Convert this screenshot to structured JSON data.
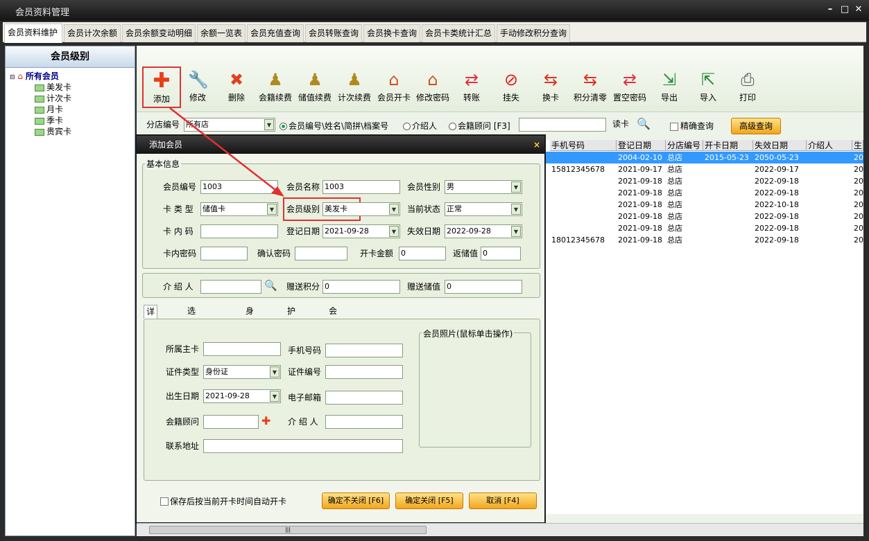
{
  "window": {
    "title": "会员资料管理"
  },
  "menu_tabs": [
    "会员资料维护",
    "会员计次余额",
    "会员余额变动明细",
    "余额一览表",
    "会员充值查询",
    "会员转账查询",
    "会员换卡查询",
    "会员卡类统计汇总",
    "手动修改积分查询"
  ],
  "left_panel": {
    "header": "会员级别",
    "root": "所有会员",
    "items": [
      "美发卡",
      "计次卡",
      "月卡",
      "季卡",
      "贵宾卡"
    ]
  },
  "toolbar": {
    "buttons": [
      {
        "label": "添加",
        "icon": "add-icon"
      },
      {
        "label": "修改",
        "icon": "wrench-icon"
      },
      {
        "label": "删除",
        "icon": "delete-icon"
      },
      {
        "label": "会籍续费",
        "icon": "pawn-icon"
      },
      {
        "label": "储值续费",
        "icon": "pawn-icon"
      },
      {
        "label": "计次续费",
        "icon": "pawn-icon"
      },
      {
        "label": "会员开卡",
        "icon": "house-icon"
      },
      {
        "label": "修改密码",
        "icon": "house-icon"
      },
      {
        "label": "转账",
        "icon": "transfer-icon"
      },
      {
        "label": "挂失",
        "icon": "ban-icon"
      },
      {
        "label": "换卡",
        "icon": "swap-icon"
      },
      {
        "label": "积分清零",
        "icon": "swap-icon"
      },
      {
        "label": "置空密码",
        "icon": "transfer-icon"
      },
      {
        "label": "导出",
        "icon": "export-icon"
      },
      {
        "label": "导入",
        "icon": "import-icon"
      },
      {
        "label": "打印",
        "icon": "print-icon"
      }
    ]
  },
  "search": {
    "branch_label": "分店编号",
    "branch_value": "所有店",
    "radio1": "会员编号\\姓名\\简拼\\档案号",
    "radio2": "介绍人",
    "radio3": "会籍顾问 [F3]",
    "read_card": "读卡",
    "exact": "精确查询",
    "advanced": "高级查询"
  },
  "grid": {
    "columns": [
      "手机号码",
      "登记日期",
      "分店编号",
      "开卡日期",
      "失效日期",
      "介绍人",
      "生"
    ],
    "rows": [
      [
        "",
        "2004-02-10",
        "总店",
        "2015-05-23",
        "2050-05-23",
        "",
        "20"
      ],
      [
        "15812345678",
        "2021-09-17",
        "总店",
        "",
        "2022-09-17",
        "",
        "20"
      ],
      [
        "",
        "2021-09-18",
        "总店",
        "",
        "2022-09-18",
        "",
        "20"
      ],
      [
        "",
        "2021-09-18",
        "总店",
        "",
        "2022-09-18",
        "",
        "20"
      ],
      [
        "",
        "2021-09-18",
        "总店",
        "",
        "2022-10-18",
        "",
        "20"
      ],
      [
        "",
        "2021-09-18",
        "总店",
        "",
        "2022-09-18",
        "",
        "20"
      ],
      [
        "",
        "2021-09-18",
        "总店",
        "",
        "2022-09-18",
        "",
        "20"
      ],
      [
        "18012345678",
        "2021-09-18",
        "总店",
        "",
        "2022-09-18",
        "",
        "20"
      ]
    ]
  },
  "dialog": {
    "title": "添加会员",
    "close": "×",
    "basic_info": "基本信息",
    "member_no_label": "会员编号",
    "member_no": "1003",
    "member_name_label": "会员名称",
    "member_name": "1003",
    "gender_label": "会员性别",
    "gender": "男",
    "card_type_label": "卡 类 型",
    "card_type": "储值卡",
    "level_label": "会员级别",
    "level": "美发卡",
    "status_label": "当前状态",
    "status": "正常",
    "inner_code_label": "卡 内 码",
    "inner_code": "",
    "reg_date_label": "登记日期",
    "reg_date": "2021-09-28",
    "expire_label": "失效日期",
    "expire_date": "2022-09-28",
    "card_pwd_label": "卡内密码",
    "card_pwd": "",
    "confirm_pwd_label": "确认密码",
    "confirm_pwd": "",
    "open_amount_label": "开卡金额",
    "open_amount": "0",
    "refund_label": "返储值",
    "refund": "0",
    "referrer_label": "介 绍 人",
    "referrer": "",
    "gift_points_label": "赠送积分",
    "gift_points": "0",
    "gift_value_label": "赠送储值",
    "gift_value": "0",
    "tabs": [
      "详细信息",
      "选择会员套餐",
      "身体状况",
      "护理计划",
      "会员爱好以及其他信息"
    ],
    "main_card_label": "所属主卡",
    "main_card": "",
    "phone_label": "手机号码",
    "phone": "",
    "id_type_label": "证件类型",
    "id_type": "身份证",
    "id_no_label": "证件编号",
    "id_no": "",
    "birth_label": "出生日期",
    "birth": "2021-09-28",
    "email_label": "电子邮箱",
    "email": "",
    "advisor_label": "会籍顾问",
    "advisor": "",
    "referrer2_label": "介 绍 人",
    "referrer2": "",
    "address_label": "联系地址",
    "address": "",
    "photo_label": "会员照片(鼠标单击操作)",
    "auto_open": "保存后按当前开卡时间自动开卡",
    "btn_ok_keep": "确定不关闭 [F6]",
    "btn_ok_close": "确定关闭 [F5]",
    "btn_cancel": "取消 [F4]"
  },
  "colors": {
    "accent": "#e03030",
    "selected_row": "#3399ff",
    "button": "#f2a51c"
  }
}
